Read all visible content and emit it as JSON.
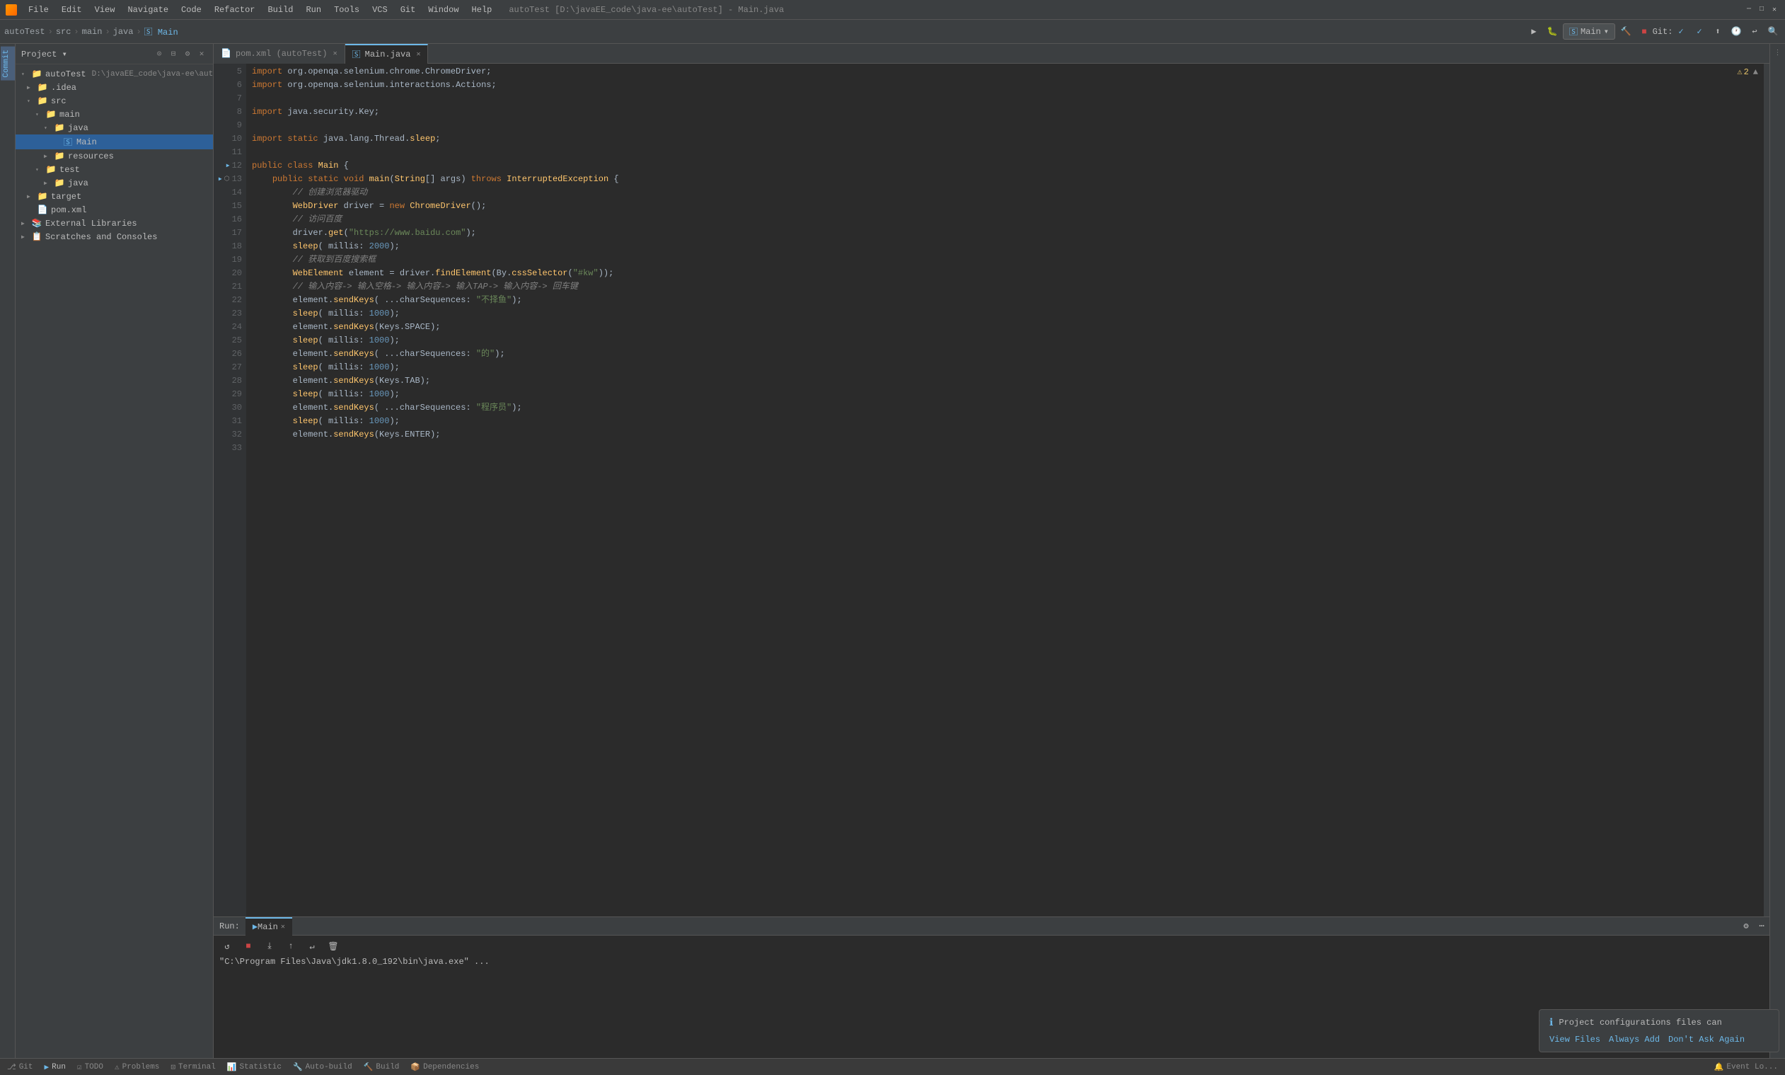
{
  "titlebar": {
    "title": "autoTest [D:\\javaEE_code\\java-ee\\autoTest] - Main.java",
    "menus": [
      "File",
      "Edit",
      "View",
      "Navigate",
      "Code",
      "Refactor",
      "Build",
      "Run",
      "Tools",
      "VCS",
      "Git",
      "Window",
      "Help"
    ],
    "path": "autoTest [D:\\javaEE_code\\java-ee\\autoTest] - Main.java"
  },
  "toolbar": {
    "breadcrumb": [
      "autoTest",
      "src",
      "main",
      "java",
      "Main"
    ],
    "run_config": "Main",
    "git_label": "Git:"
  },
  "sidebar": {
    "title": "Project",
    "items": [
      {
        "id": "autoTest",
        "label": "autoTest",
        "path": "D:\\javaEE_code\\java-ee\\autoTest",
        "level": 0,
        "type": "project",
        "expanded": true
      },
      {
        "id": "idea",
        "label": ".idea",
        "level": 1,
        "type": "folder",
        "expanded": false
      },
      {
        "id": "src",
        "label": "src",
        "level": 1,
        "type": "folder",
        "expanded": true
      },
      {
        "id": "main",
        "label": "main",
        "level": 2,
        "type": "folder",
        "expanded": true
      },
      {
        "id": "java",
        "label": "java",
        "level": 3,
        "type": "folder",
        "expanded": true
      },
      {
        "id": "Main",
        "label": "Main",
        "level": 4,
        "type": "java",
        "selected": true
      },
      {
        "id": "resources",
        "label": "resources",
        "level": 3,
        "type": "folder",
        "expanded": false
      },
      {
        "id": "test",
        "label": "test",
        "level": 2,
        "type": "folder",
        "expanded": true
      },
      {
        "id": "java2",
        "label": "java",
        "level": 3,
        "type": "folder",
        "expanded": false
      },
      {
        "id": "target",
        "label": "target",
        "level": 1,
        "type": "folder",
        "expanded": false
      },
      {
        "id": "pom",
        "label": "pom.xml",
        "level": 1,
        "type": "xml"
      },
      {
        "id": "ext-lib",
        "label": "External Libraries",
        "level": 0,
        "type": "folder",
        "expanded": false
      },
      {
        "id": "scratches",
        "label": "Scratches and Consoles",
        "level": 0,
        "type": "scratches"
      }
    ]
  },
  "tabs": [
    {
      "label": "pom.xml (autoTest)",
      "type": "xml",
      "active": false,
      "id": "pom"
    },
    {
      "label": "Main.java",
      "type": "java",
      "active": true,
      "id": "main"
    }
  ],
  "code": {
    "lines": [
      {
        "num": 5,
        "content": "import org.openqa.selenium.chrome.ChromeDriver;",
        "tokens": [
          {
            "t": "kw",
            "v": "import "
          },
          {
            "t": "",
            "v": "org.openqa.selenium.chrome.ChromeDriver;"
          }
        ]
      },
      {
        "num": 6,
        "content": "import org.openqa.selenium.interactions.Actions;",
        "tokens": [
          {
            "t": "kw",
            "v": "import "
          },
          {
            "t": "",
            "v": "org.openqa.selenium.interactions.Actions;"
          }
        ]
      },
      {
        "num": 7,
        "content": ""
      },
      {
        "num": 8,
        "content": "import java.security.Key;",
        "tokens": [
          {
            "t": "kw",
            "v": "import "
          },
          {
            "t": "",
            "v": "java.security.Key;"
          }
        ]
      },
      {
        "num": 9,
        "content": ""
      },
      {
        "num": 10,
        "content": "import static java.lang.Thread.sleep;",
        "tokens": [
          {
            "t": "kw",
            "v": "import "
          },
          {
            "t": "kw",
            "v": "static "
          },
          {
            "t": "",
            "v": "java.lang.Thread."
          },
          {
            "t": "fn",
            "v": "sleep"
          },
          {
            "t": "",
            "v": ";"
          }
        ],
        "has_run": false
      },
      {
        "num": 11,
        "content": ""
      },
      {
        "num": 12,
        "content": "public class Main {",
        "tokens": [
          {
            "t": "kw",
            "v": "public "
          },
          {
            "t": "kw",
            "v": "class "
          },
          {
            "t": "cls",
            "v": "Main"
          },
          {
            "t": "",
            "v": " {"
          }
        ],
        "has_arrow": true
      },
      {
        "num": 13,
        "content": "    public static void main(String[] args) throws InterruptedException {",
        "tokens": [
          {
            "t": "kw",
            "v": "    public "
          },
          {
            "t": "kw",
            "v": "static "
          },
          {
            "t": "kw",
            "v": "void "
          },
          {
            "t": "fn",
            "v": "main"
          },
          {
            "t": "",
            "v": "("
          },
          {
            "t": "cls",
            "v": "String"
          },
          {
            "t": "",
            "v": "[] "
          },
          {
            "t": "param",
            "v": "args"
          },
          {
            "t": "",
            "v": ") "
          },
          {
            "t": "kw",
            "v": "throws "
          },
          {
            "t": "cls",
            "v": "InterruptedException"
          },
          {
            "t": "",
            "v": " {"
          }
        ],
        "has_arrow": true,
        "has_debug": true
      },
      {
        "num": 14,
        "content": "        // 创建浏览器驱动",
        "tokens": [
          {
            "t": "comment",
            "v": "        // 创建浏览器驱动"
          }
        ]
      },
      {
        "num": 15,
        "content": "        WebDriver driver = new ChromeDriver();",
        "tokens": [
          {
            "t": "cls",
            "v": "        WebDriver"
          },
          {
            "t": "",
            "v": " driver = "
          },
          {
            "t": "kw",
            "v": "new "
          },
          {
            "t": "cls",
            "v": "ChromeDriver"
          },
          {
            "t": "",
            "v": "();"
          }
        ]
      },
      {
        "num": 16,
        "content": "        // 访问百度",
        "tokens": [
          {
            "t": "comment",
            "v": "        // 访问百度"
          }
        ]
      },
      {
        "num": 17,
        "content": "        driver.get(\"https://www.baidu.com\");",
        "tokens": [
          {
            "t": "",
            "v": "        driver."
          },
          {
            "t": "fn",
            "v": "get"
          },
          {
            "t": "",
            "v": "("
          },
          {
            "t": "str",
            "v": "\"https://www.baidu.com\""
          },
          {
            "t": "",
            "v": ");"
          }
        ]
      },
      {
        "num": 18,
        "content": "        sleep( millis: 2000);",
        "tokens": [
          {
            "t": "fn",
            "v": "        sleep"
          },
          {
            "t": "",
            "v": "( "
          },
          {
            "t": "param",
            "v": "millis"
          },
          {
            "t": "",
            "v": ": "
          },
          {
            "t": "num",
            "v": "2000"
          },
          {
            "t": "",
            "v": ");"
          }
        ]
      },
      {
        "num": 19,
        "content": "        // 获取到百度搜索框",
        "tokens": [
          {
            "t": "comment",
            "v": "        // 获取到百度搜索框"
          }
        ]
      },
      {
        "num": 20,
        "content": "        WebElement element = driver.findElement(By.cssSelector(\"#kw\"));",
        "tokens": [
          {
            "t": "cls",
            "v": "        WebElement"
          },
          {
            "t": "",
            "v": " element = driver."
          },
          {
            "t": "fn",
            "v": "findElement"
          },
          {
            "t": "",
            "v": "(By."
          },
          {
            "t": "fn",
            "v": "cssSelector"
          },
          {
            "t": "",
            "v": "("
          },
          {
            "t": "str",
            "v": "\"#kw\""
          },
          {
            "t": "",
            "v": "'));"
          }
        ]
      },
      {
        "num": 21,
        "content": "        // 输入内容-> 输入空格-> 输入内容-> 输入TAP-> 输入内容-> 回车键",
        "tokens": [
          {
            "t": "comment",
            "v": "        // 输入内容-> 输入空格-> 输入内容-> 输入TAP-> 输入内容-> 回车键"
          }
        ]
      },
      {
        "num": 22,
        "content": "        element.sendKeys( ...charSequences: \"不择鱼\");",
        "tokens": [
          {
            "t": "",
            "v": "        element."
          },
          {
            "t": "fn",
            "v": "sendKeys"
          },
          {
            "t": "",
            "v": "( "
          },
          {
            "t": "param",
            "v": "...charSequences"
          },
          {
            "t": "",
            "v": ": "
          },
          {
            "t": "str",
            "v": "\"不择鱼\""
          },
          {
            "t": "",
            "v": ");"
          }
        ]
      },
      {
        "num": 23,
        "content": "        sleep( millis: 1000);",
        "tokens": [
          {
            "t": "fn",
            "v": "        sleep"
          },
          {
            "t": "",
            "v": "( "
          },
          {
            "t": "param",
            "v": "millis"
          },
          {
            "t": "",
            "v": ": "
          },
          {
            "t": "num",
            "v": "1000"
          },
          {
            "t": "",
            "v": ");"
          }
        ]
      },
      {
        "num": 24,
        "content": "        element.sendKeys(Keys.SPACE);",
        "tokens": [
          {
            "t": "",
            "v": "        element."
          },
          {
            "t": "fn",
            "v": "sendKeys"
          },
          {
            "t": "",
            "v": "(Keys."
          },
          {
            "t": "",
            "v": "SPACE"
          },
          {
            "t": "",
            "v": ");"
          }
        ]
      },
      {
        "num": 25,
        "content": "        sleep( millis: 1000);",
        "tokens": [
          {
            "t": "fn",
            "v": "        sleep"
          },
          {
            "t": "",
            "v": "( "
          },
          {
            "t": "param",
            "v": "millis"
          },
          {
            "t": "",
            "v": ": "
          },
          {
            "t": "num",
            "v": "1000"
          },
          {
            "t": "",
            "v": ");"
          }
        ]
      },
      {
        "num": 26,
        "content": "        element.sendKeys( ...charSequences: \"的\");",
        "tokens": [
          {
            "t": "",
            "v": "        element."
          },
          {
            "t": "fn",
            "v": "sendKeys"
          },
          {
            "t": "",
            "v": "( "
          },
          {
            "t": "param",
            "v": "...charSequences"
          },
          {
            "t": "",
            "v": ": "
          },
          {
            "t": "str",
            "v": "\"的\""
          },
          {
            "t": "",
            "v": ");"
          }
        ]
      },
      {
        "num": 27,
        "content": "        sleep( millis: 1000);",
        "tokens": [
          {
            "t": "fn",
            "v": "        sleep"
          },
          {
            "t": "",
            "v": "( "
          },
          {
            "t": "param",
            "v": "millis"
          },
          {
            "t": "",
            "v": ": "
          },
          {
            "t": "num",
            "v": "1000"
          },
          {
            "t": "",
            "v": ");"
          }
        ]
      },
      {
        "num": 28,
        "content": "        element.sendKeys(Keys.TAB);",
        "tokens": [
          {
            "t": "",
            "v": "        element."
          },
          {
            "t": "fn",
            "v": "sendKeys"
          },
          {
            "t": "",
            "v": "(Keys."
          },
          {
            "t": "",
            "v": "TAB"
          },
          {
            "t": "",
            "v": ");"
          }
        ]
      },
      {
        "num": 29,
        "content": "        sleep( millis: 1000);",
        "tokens": [
          {
            "t": "fn",
            "v": "        sleep"
          },
          {
            "t": "",
            "v": "( "
          },
          {
            "t": "param",
            "v": "millis"
          },
          {
            "t": "",
            "v": ": "
          },
          {
            "t": "num",
            "v": "1000"
          },
          {
            "t": "",
            "v": ");"
          }
        ]
      },
      {
        "num": 30,
        "content": "        element.sendKeys( ...charSequences: \"程序员\");",
        "tokens": [
          {
            "t": "",
            "v": "        element."
          },
          {
            "t": "fn",
            "v": "sendKeys"
          },
          {
            "t": "",
            "v": "( "
          },
          {
            "t": "param",
            "v": "...charSequences"
          },
          {
            "t": "",
            "v": ": "
          },
          {
            "t": "str",
            "v": "\"程序员\""
          },
          {
            "t": "",
            "v": ");"
          }
        ]
      },
      {
        "num": 31,
        "content": "        sleep( millis: 1000);",
        "tokens": [
          {
            "t": "fn",
            "v": "        sleep"
          },
          {
            "t": "",
            "v": "( "
          },
          {
            "t": "param",
            "v": "millis"
          },
          {
            "t": "",
            "v": ": "
          },
          {
            "t": "num",
            "v": "1000"
          },
          {
            "t": "",
            "v": ");"
          }
        ]
      },
      {
        "num": 32,
        "content": "        element.sendKeys(Keys.ENTER);",
        "tokens": [
          {
            "t": "",
            "v": "        element."
          },
          {
            "t": "fn",
            "v": "sendKeys"
          },
          {
            "t": "",
            "v": "(Keys."
          },
          {
            "t": "",
            "v": "ENTER"
          },
          {
            "t": "",
            "v": ");"
          }
        ]
      },
      {
        "num": 33,
        "content": ""
      }
    ]
  },
  "run_panel": {
    "label": "Run:",
    "tab": "Main",
    "command": "\"C:\\Program Files\\Java\\jdk1.8.0_192\\bin\\java.exe\" ..."
  },
  "bottom_status": {
    "items": [
      "Git",
      "Run",
      "TODO",
      "Problems",
      "Terminal",
      "Statistic",
      "Auto-build",
      "Build",
      "Dependencies"
    ]
  },
  "notification": {
    "text": "Project configurations files can",
    "actions": [
      "View Files",
      "Always Add",
      "Don't Ask Again"
    ]
  },
  "warning": {
    "text": "⚠ 2"
  },
  "icons": {
    "project": "📁",
    "folder": "📁",
    "java": "☕",
    "xml": "📄",
    "scratches": "📋",
    "ext_lib": "📚"
  }
}
